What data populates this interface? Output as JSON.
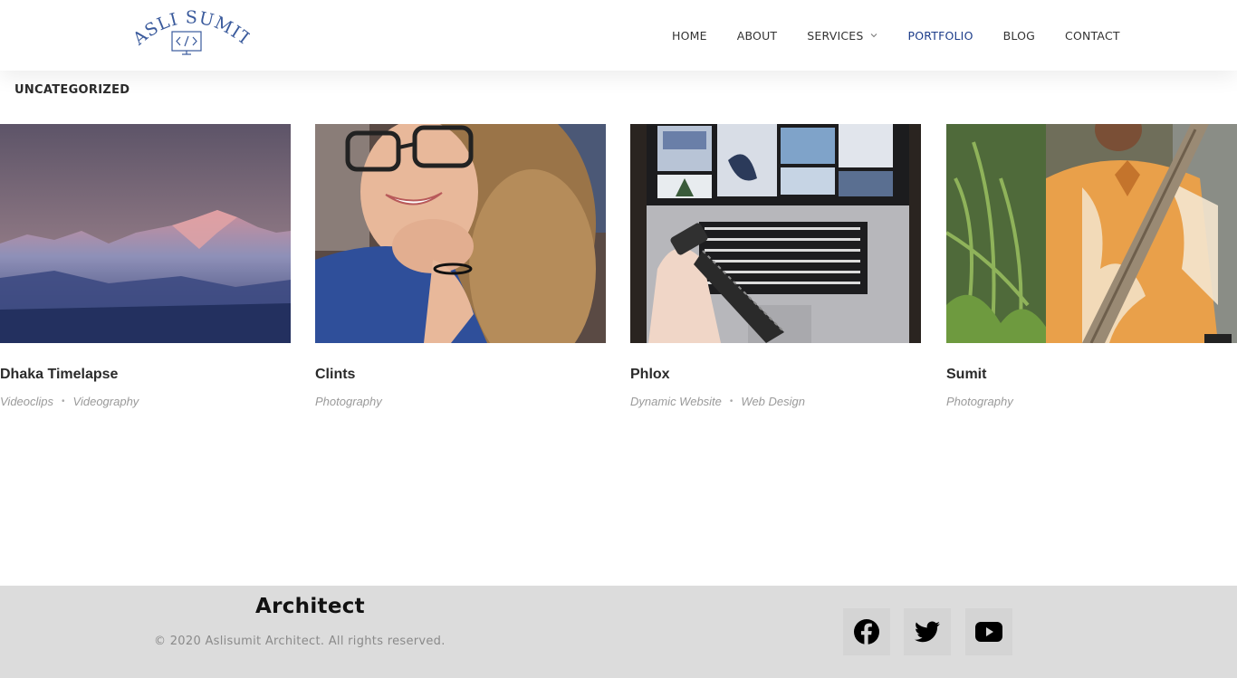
{
  "header": {
    "logo_text": "ASLI SUMIT",
    "logo_icon": "code-monitor-icon",
    "nav": [
      {
        "label": "HOME"
      },
      {
        "label": "ABOUT"
      },
      {
        "label": "SERVICES",
        "has_dropdown": true
      },
      {
        "label": "PORTFOLIO",
        "active": true
      },
      {
        "label": "BLOG"
      },
      {
        "label": "CONTACT"
      }
    ],
    "active_color": "#1d3d8a"
  },
  "category": {
    "title": "UNCATEGORIZED"
  },
  "portfolio": [
    {
      "title": "Dhaka Timelapse",
      "tags": [
        "Videoclips",
        "Videography"
      ],
      "image": "snowy-mountain-range-at-dusk"
    },
    {
      "title": "Clints",
      "tags": [
        "Photography"
      ],
      "image": "smiling-woman-with-glasses"
    },
    {
      "title": "Phlox",
      "tags": [
        "Dynamic Website",
        "Web Design"
      ],
      "image": "laptop-with-photo-prints-and-film"
    },
    {
      "title": "Sumit",
      "tags": [
        "Photography"
      ],
      "image": "man-in-orange-tie-dye-shirt-among-plants"
    }
  ],
  "footer": {
    "title": "Architect",
    "copyright": "© 2020 Aslisumit Architect. All rights reserved.",
    "social": [
      "facebook-icon",
      "twitter-icon",
      "youtube-icon"
    ],
    "background": "#dcdcdc"
  }
}
